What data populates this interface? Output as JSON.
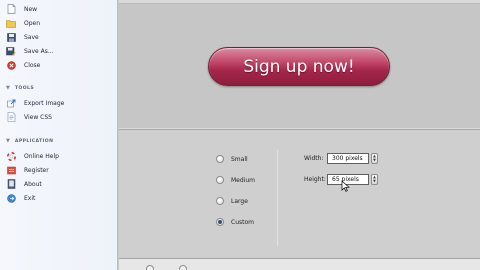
{
  "sidebar": {
    "file_items": [
      {
        "label": "New",
        "icon": "new-document-icon"
      },
      {
        "label": "Open",
        "icon": "folder-icon"
      },
      {
        "label": "Save",
        "icon": "floppy-disk-icon"
      },
      {
        "label": "Save As...",
        "icon": "save-as-icon"
      },
      {
        "label": "Close",
        "icon": "close-icon"
      }
    ],
    "tools_header": "TOOLS",
    "tools_items": [
      {
        "label": "Export Image",
        "icon": "export-icon"
      },
      {
        "label": "View CSS",
        "icon": "css-document-icon"
      }
    ],
    "application_header": "APPLICATION",
    "application_items": [
      {
        "label": "Online Help",
        "icon": "lifebuoy-icon"
      },
      {
        "label": "Register",
        "icon": "register-icon"
      },
      {
        "label": "About",
        "icon": "info-icon"
      },
      {
        "label": "Exit",
        "icon": "exit-icon"
      }
    ]
  },
  "preview": {
    "button_text": "Sign up now!",
    "button_color": "#a5274b"
  },
  "size_options": {
    "options": [
      "Small",
      "Medium",
      "Large",
      "Custom"
    ],
    "selected": "Custom"
  },
  "dimensions": {
    "width_label": "Width:",
    "width_value": "300 pixels",
    "height_label": "Height:",
    "height_value": "65 pixels"
  }
}
